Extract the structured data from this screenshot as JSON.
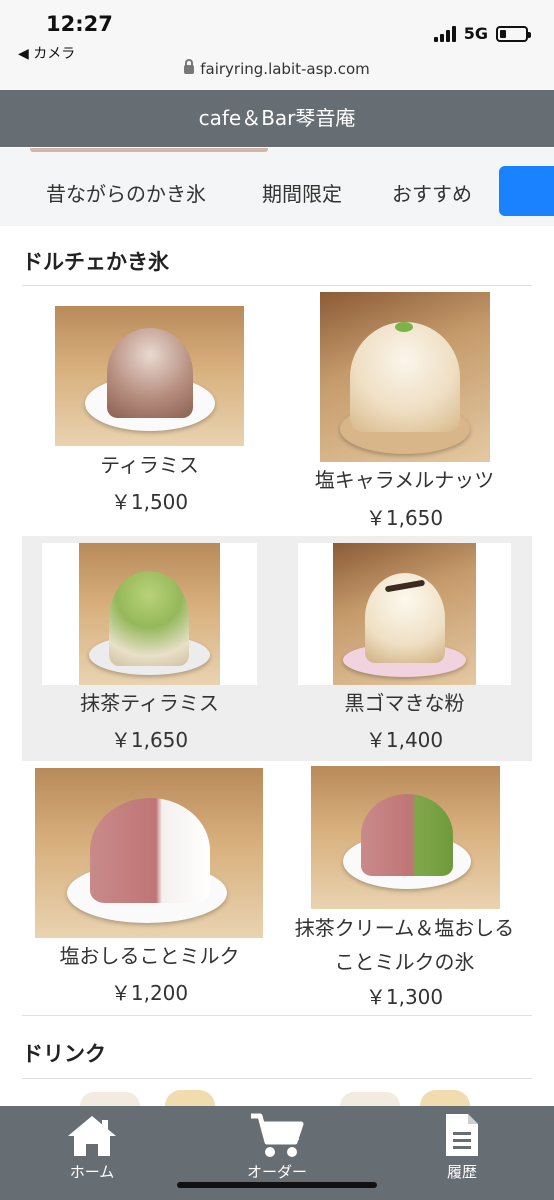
{
  "status_bar": {
    "time": "12:27",
    "back_app": "◀ カメラ",
    "network": "5G",
    "battery_level": 0.25
  },
  "browser": {
    "url": "fairyring.labit-asp.com"
  },
  "header": {
    "title": "cafe＆Bar琴音庵"
  },
  "category_tabs": [
    {
      "label": "昔ながらのかき氷"
    },
    {
      "label": "期間限定"
    },
    {
      "label": "おすすめ"
    }
  ],
  "sections": [
    {
      "title": "ドルチェかき氷",
      "items": [
        {
          "name": "ティラミス",
          "price": "￥1,500"
        },
        {
          "name": "塩キャラメルナッツ",
          "price": "￥1,650"
        },
        {
          "name": "抹茶ティラミス",
          "price": "￥1,650"
        },
        {
          "name": "黒ゴマきな粉",
          "price": "￥1,400"
        },
        {
          "name": "塩おしることミルク",
          "price": "￥1,200"
        },
        {
          "name": "抹茶クリーム＆塩おしる",
          "name_line2": "ことミルクの氷",
          "price": "￥1,300"
        }
      ]
    },
    {
      "title": "ドリンク"
    }
  ],
  "bottom_nav": [
    {
      "label": "ホーム",
      "icon": "home-icon"
    },
    {
      "label": "オーダー",
      "icon": "cart-icon"
    },
    {
      "label": "履歴",
      "icon": "document-icon"
    }
  ],
  "colors": {
    "header": "#676e73",
    "tab_active": "#1a82ff",
    "tab_bar": "#f4f5f6",
    "row_highlight": "#eeeeee"
  }
}
